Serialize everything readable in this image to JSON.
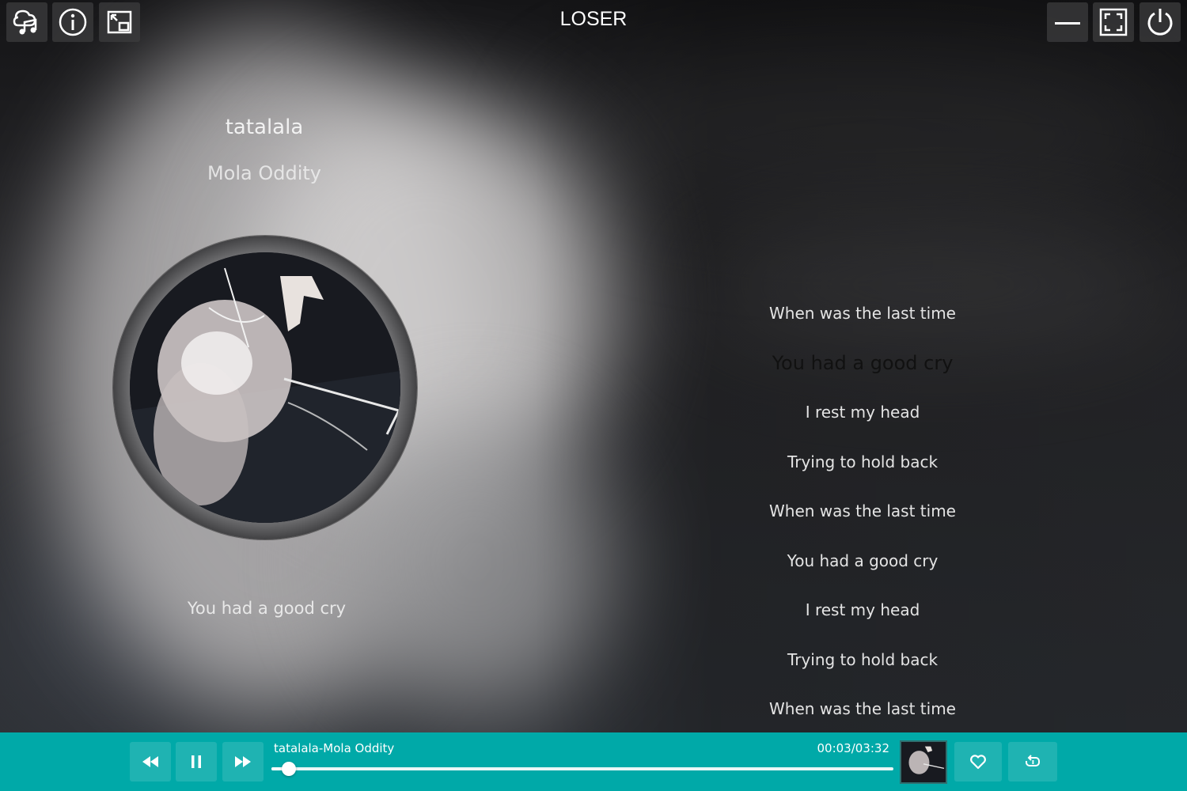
{
  "window": {
    "title": "LOSER",
    "left_buttons": [
      {
        "name": "music-library-icon"
      },
      {
        "name": "info-icon"
      },
      {
        "name": "mini-mode-icon"
      }
    ],
    "right_buttons": [
      {
        "name": "minimize-icon"
      },
      {
        "name": "fullscreen-icon"
      },
      {
        "name": "power-icon"
      }
    ]
  },
  "song": {
    "title": "tatalala",
    "artist": "Mola Oddity",
    "current_lyric": "You had a good cry"
  },
  "lyrics": {
    "active_index": 1,
    "lines": [
      "When was the last time",
      "You had a good cry",
      "I rest my head",
      "Trying to hold back",
      "When was the last time",
      "You had a good cry",
      "I rest my head",
      "Trying to hold back",
      "When was the last time"
    ]
  },
  "player": {
    "now_playing": "tatalala-Mola Oddity",
    "time": "00:03/03:32",
    "progress": 0.028,
    "controls": {
      "prev": "rewind-icon",
      "play_pause": "pause-icon",
      "next": "fast-forward-icon",
      "like": "heart-icon",
      "repeat": "repeat-icon"
    },
    "colors": {
      "bar": "#00a9a8",
      "text": "#ffffff"
    }
  }
}
